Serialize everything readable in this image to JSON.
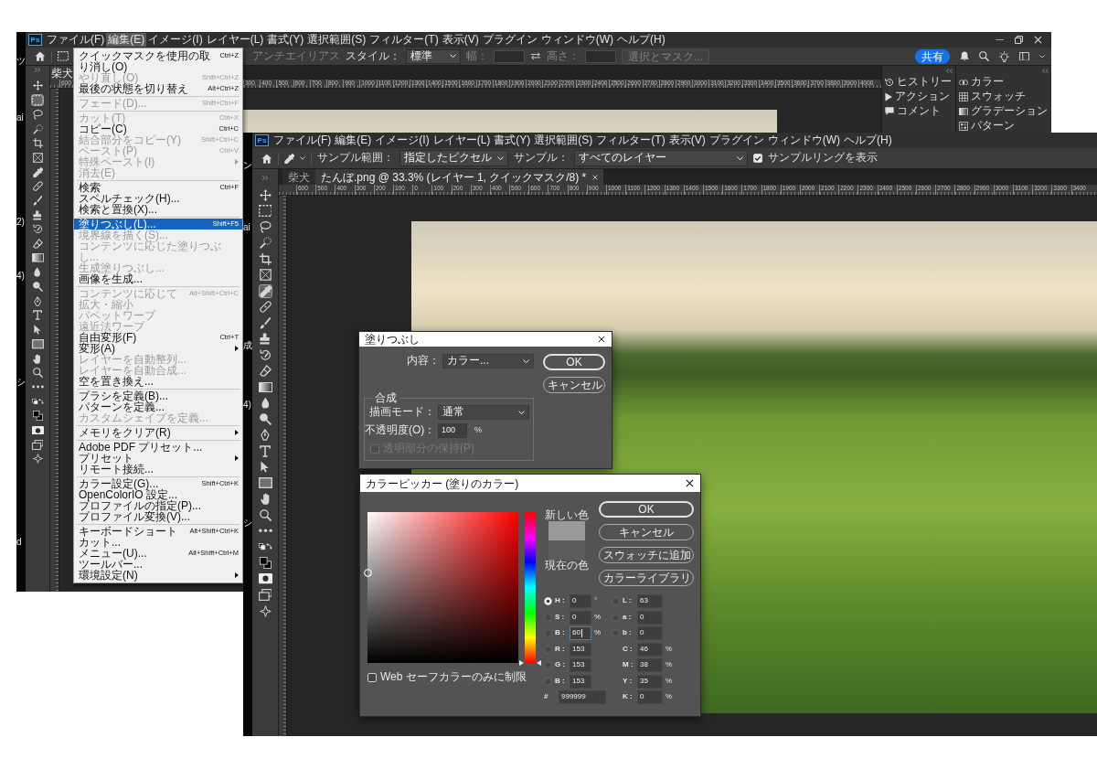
{
  "back_window": {
    "edge_fragments": [
      "ツ",
      "ai",
      "2)",
      "4)",
      "シ",
      "d"
    ],
    "logo": "Ps",
    "menu": [
      {
        "label": "ファイル(F)",
        "selected": false
      },
      {
        "label": "編集(E)",
        "selected": true
      },
      {
        "label": "イメージ(I)",
        "selected": false
      },
      {
        "label": "レイヤー(L)",
        "selected": false
      },
      {
        "label": "書式(Y)",
        "selected": false
      },
      {
        "label": "選択範囲(S)",
        "selected": false
      },
      {
        "label": "フィルター(T)",
        "selected": false
      },
      {
        "label": "表示(V)",
        "selected": false
      },
      {
        "label": "プラグイン",
        "selected": false
      },
      {
        "label": "ウィンドウ(W)",
        "selected": false
      },
      {
        "label": "ヘルプ(H)",
        "selected": false
      }
    ],
    "options_bar": [
      {
        "kind": "label",
        "text": "アンチエイリアス",
        "disabled": true
      },
      {
        "kind": "label",
        "text": "スタイル：",
        "disabled": false
      },
      {
        "kind": "select",
        "value": "標準",
        "disabled": false
      },
      {
        "kind": "label",
        "text": "幅：",
        "disabled": true
      },
      {
        "kind": "input",
        "disabled": true
      },
      {
        "kind": "swap",
        "disabled": false
      },
      {
        "kind": "label",
        "text": "高さ：",
        "disabled": true
      },
      {
        "kind": "input",
        "disabled": true
      },
      {
        "kind": "button",
        "text": "選択とマスク...",
        "disabled": true
      }
    ],
    "share_button": "共有",
    "tools": [
      {
        "kind": "move",
        "selected": false
      },
      {
        "kind": "marquee",
        "selected": true
      },
      {
        "kind": "lasso",
        "selected": false
      },
      {
        "kind": "quickselect",
        "selected": false
      },
      {
        "kind": "crop",
        "selected": false
      },
      {
        "kind": "frame",
        "selected": false
      },
      {
        "kind": "eyedropper",
        "selected": false
      },
      {
        "kind": "heal",
        "selected": false
      },
      {
        "kind": "brush",
        "selected": false
      },
      {
        "kind": "stamp",
        "selected": false
      },
      {
        "kind": "historybrush",
        "selected": false
      },
      {
        "kind": "eraser",
        "selected": false
      },
      {
        "kind": "gradient",
        "selected": false
      },
      {
        "kind": "blur",
        "selected": false
      },
      {
        "kind": "dodge",
        "selected": false
      },
      {
        "kind": "pen",
        "selected": false
      },
      {
        "kind": "type",
        "selected": false
      },
      {
        "kind": "pathselect",
        "selected": false
      },
      {
        "kind": "rectangle",
        "selected": false
      },
      {
        "kind": "hand",
        "selected": false
      },
      {
        "kind": "zoom",
        "selected": false
      },
      {
        "kind": "more",
        "selected": false
      },
      {
        "kind": "swap",
        "selected": false
      },
      {
        "kind": "colors",
        "selected": false
      },
      {
        "kind": "quickmask",
        "selected": false
      },
      {
        "kind": "screenmode",
        "selected": false
      },
      {
        "kind": "sparkle",
        "selected": false
      }
    ],
    "tabs": [
      {
        "label": "柴犬",
        "selected": true,
        "closable": false
      }
    ],
    "ruler_left_labels": [
      "600"
    ],
    "ruler_labels": [
      "300",
      "400",
      "500",
      "600",
      "700",
      "800",
      "900",
      "1000",
      "1100",
      "1200",
      "1300",
      "1400",
      "1500",
      "1600",
      "1700",
      "1800",
      "1900",
      "2000",
      "2100",
      "2200",
      "2300",
      "2400",
      "2500",
      "2600",
      "2700",
      "2800",
      "2900",
      "3000",
      "3100",
      "3200",
      "3300",
      "3400",
      "3500",
      "3600",
      "3700",
      "3800",
      "3900",
      "4000"
    ],
    "dock": [
      [
        {
          "kind": "history",
          "label": "ヒストリー"
        },
        {
          "kind": "actions",
          "label": "アクション"
        },
        {
          "kind": "comments",
          "label": "コメント"
        }
      ],
      [
        {
          "kind": "color",
          "label": "カラー"
        },
        {
          "kind": "swatches",
          "label": "スウォッチ"
        },
        {
          "kind": "gradients",
          "label": "グラデーション"
        },
        {
          "kind": "patterns",
          "label": "パターン"
        }
      ]
    ],
    "edit_menu": {
      "sections": [
        {
          "items": [
            {
              "label": "クイックマスクを使用の取り消し(O)",
              "shortcut": "Ctrl+Z",
              "arrow": false,
              "disabled": false,
              "selected": false
            },
            {
              "label": "やり直し(O)",
              "shortcut": "Shift+Ctrl+Z",
              "arrow": false,
              "disabled": true,
              "selected": false
            },
            {
              "label": "最後の状態を切り替え",
              "shortcut": "Alt+Ctrl+Z",
              "arrow": false,
              "disabled": false,
              "selected": false
            }
          ]
        },
        {
          "items": [
            {
              "label": "フェード(D)...",
              "shortcut": "Shift+Ctrl+F",
              "arrow": false,
              "disabled": true,
              "selected": false
            }
          ]
        },
        {
          "items": [
            {
              "label": "カット(T)",
              "shortcut": "Ctrl+X",
              "arrow": false,
              "disabled": true,
              "selected": false
            },
            {
              "label": "コピー(C)",
              "shortcut": "Ctrl+C",
              "arrow": false,
              "disabled": false,
              "selected": false
            },
            {
              "label": "結合部分をコピー(Y)",
              "shortcut": "Shift+Ctrl+C",
              "arrow": false,
              "disabled": true,
              "selected": false
            },
            {
              "label": "ペースト(P)",
              "shortcut": "Ctrl+V",
              "arrow": false,
              "disabled": true,
              "selected": false
            },
            {
              "label": "特殊ペースト(I)",
              "arrow": true,
              "disabled": true,
              "selected": false
            },
            {
              "label": "消去(E)",
              "arrow": false,
              "disabled": true,
              "selected": false
            }
          ]
        },
        {
          "items": [
            {
              "label": "検索",
              "shortcut": "Ctrl+F",
              "arrow": false,
              "disabled": false,
              "selected": false
            },
            {
              "label": "スペルチェック(H)...",
              "arrow": false,
              "disabled": false,
              "selected": false
            },
            {
              "label": "検索と置換(X)...",
              "arrow": false,
              "disabled": false,
              "selected": false
            }
          ]
        },
        {
          "items": [
            {
              "label": "塗りつぶし(L)...",
              "shortcut": "Shift+F5",
              "arrow": false,
              "disabled": false,
              "selected": true
            },
            {
              "label": "境界線を描く(S)...",
              "arrow": false,
              "disabled": true,
              "selected": false
            },
            {
              "label": "コンテンツに応じた塗りつぶし...",
              "arrow": false,
              "disabled": true,
              "selected": false
            },
            {
              "label": "生成塗りつぶし...",
              "arrow": false,
              "disabled": true,
              "selected": false
            },
            {
              "label": "画像を生成...",
              "arrow": false,
              "disabled": false,
              "selected": false
            }
          ]
        },
        {
          "items": [
            {
              "label": "コンテンツに応じて拡大・縮小",
              "shortcut": "Alt+Shift+Ctrl+C",
              "arrow": false,
              "disabled": true,
              "selected": false
            },
            {
              "label": "パペットワープ",
              "arrow": false,
              "disabled": true,
              "selected": false
            },
            {
              "label": "遠近法ワープ",
              "arrow": false,
              "disabled": true,
              "selected": false
            },
            {
              "label": "自由変形(F)",
              "shortcut": "Ctrl+T",
              "arrow": false,
              "disabled": false,
              "selected": false
            },
            {
              "label": "変形(A)",
              "arrow": true,
              "disabled": false,
              "selected": false
            },
            {
              "label": "レイヤーを自動整列...",
              "arrow": false,
              "disabled": true,
              "selected": false
            },
            {
              "label": "レイヤーを自動合成...",
              "arrow": false,
              "disabled": true,
              "selected": false
            },
            {
              "label": "空を置き換え...",
              "arrow": false,
              "disabled": false,
              "selected": false
            }
          ]
        },
        {
          "items": [
            {
              "label": "ブラシを定義(B)...",
              "arrow": false,
              "disabled": false,
              "selected": false
            },
            {
              "label": "パターンを定義...",
              "arrow": false,
              "disabled": false,
              "selected": false
            },
            {
              "label": "カスタムシェイプを定義...",
              "arrow": false,
              "disabled": true,
              "selected": false
            }
          ]
        },
        {
          "items": [
            {
              "label": "メモリをクリア(R)",
              "arrow": true,
              "disabled": false,
              "selected": false
            }
          ]
        },
        {
          "items": [
            {
              "label": "Adobe PDF プリセット...",
              "arrow": false,
              "disabled": false,
              "selected": false
            },
            {
              "label": "プリセット",
              "arrow": true,
              "disabled": false,
              "selected": false
            },
            {
              "label": "リモート接続...",
              "arrow": false,
              "disabled": false,
              "selected": false
            }
          ]
        },
        {
          "items": [
            {
              "label": "カラー設定(G)...",
              "shortcut": "Shift+Ctrl+K",
              "arrow": false,
              "disabled": false,
              "selected": false
            },
            {
              "label": "OpenColorIO 設定...",
              "arrow": false,
              "disabled": false,
              "selected": false
            },
            {
              "label": "プロファイルの指定(P)...",
              "arrow": false,
              "disabled": false,
              "selected": false
            },
            {
              "label": "プロファイル変換(V)...",
              "arrow": false,
              "disabled": false,
              "selected": false
            }
          ]
        },
        {
          "items": [
            {
              "label": "キーボードショートカット...",
              "shortcut": "Alt+Shift+Ctrl+K",
              "arrow": false,
              "disabled": false,
              "selected": false
            },
            {
              "label": "メニュー(U)...",
              "shortcut": "Alt+Shift+Ctrl+M",
              "arrow": false,
              "disabled": false,
              "selected": false
            },
            {
              "label": "ツールバー...",
              "arrow": false,
              "disabled": false,
              "selected": false
            },
            {
              "label": "環境設定(N)",
              "arrow": true,
              "disabled": false,
              "selected": false
            }
          ]
        }
      ]
    }
  },
  "front_window": {
    "edge_fragments": [
      "ン",
      "ai",
      "成",
      "4)",
      "シ"
    ],
    "logo": "Ps",
    "menu": [
      {
        "label": "ファイル(F)",
        "selected": false
      },
      {
        "label": "編集(E)",
        "selected": false
      },
      {
        "label": "イメージ(I)",
        "selected": false
      },
      {
        "label": "レイヤー(L)",
        "selected": false
      },
      {
        "label": "書式(Y)",
        "selected": false
      },
      {
        "label": "選択範囲(S)",
        "selected": false
      },
      {
        "label": "フィルター(T)",
        "selected": false
      },
      {
        "label": "表示(V)",
        "selected": false
      },
      {
        "label": "プラグイン",
        "selected": false
      },
      {
        "label": "ウィンドウ(W)",
        "selected": false
      },
      {
        "label": "ヘルプ(H)",
        "selected": false
      }
    ],
    "options_bar": [
      {
        "kind": "label",
        "text": "サンプル範囲：",
        "disabled": false
      },
      {
        "kind": "select",
        "value": "指定したピクセル",
        "disabled": false
      },
      {
        "kind": "label",
        "text": "サンプル：",
        "disabled": false
      },
      {
        "kind": "select",
        "value": "すべてのレイヤー",
        "disabled": false
      },
      {
        "kind": "checkbox",
        "text": "サンプルリングを表示",
        "checked": true,
        "disabled": false
      }
    ],
    "tools": [
      {
        "kind": "move",
        "selected": false
      },
      {
        "kind": "marquee",
        "selected": false
      },
      {
        "kind": "lasso",
        "selected": false
      },
      {
        "kind": "quickselect",
        "selected": false
      },
      {
        "kind": "crop",
        "selected": false
      },
      {
        "kind": "frame",
        "selected": false
      },
      {
        "kind": "eyedropper",
        "selected": true
      },
      {
        "kind": "heal",
        "selected": false
      },
      {
        "kind": "brush",
        "selected": false
      },
      {
        "kind": "stamp",
        "selected": false
      },
      {
        "kind": "historybrush",
        "selected": false
      },
      {
        "kind": "eraser",
        "selected": false
      },
      {
        "kind": "gradient",
        "selected": false
      },
      {
        "kind": "blur",
        "selected": false
      },
      {
        "kind": "dodge",
        "selected": false
      },
      {
        "kind": "pen",
        "selected": false
      },
      {
        "kind": "type",
        "selected": false
      },
      {
        "kind": "pathselect",
        "selected": false
      },
      {
        "kind": "rectangle",
        "selected": false
      },
      {
        "kind": "hand",
        "selected": false
      },
      {
        "kind": "zoom",
        "selected": false
      },
      {
        "kind": "more",
        "selected": false
      },
      {
        "kind": "swap",
        "selected": false
      },
      {
        "kind": "colors",
        "selected": false
      },
      {
        "kind": "quickmask",
        "selected": false
      },
      {
        "kind": "screenmode",
        "selected": false
      },
      {
        "kind": "sparkle",
        "selected": false
      }
    ],
    "tabs": [
      {
        "label": "柴犬",
        "selected": false,
        "closable": false
      },
      {
        "label": "たんぼ.png @ 33.3% (レイヤー 1, クイックマスク/8) *",
        "selected": true,
        "closable": true
      }
    ],
    "ruler_labels": [
      "600",
      "500",
      "400",
      "300",
      "200",
      "100",
      "0",
      "100",
      "200",
      "300",
      "400",
      "500",
      "600",
      "700",
      "800",
      "900",
      "1000",
      "1100",
      "1200",
      "1300",
      "1400",
      "1500",
      "1600",
      "1700",
      "1800",
      "1900",
      "2000",
      "2100",
      "2200",
      "2300",
      "2400",
      "2500",
      "2600",
      "2700",
      "2800",
      "2900",
      "3000",
      "3100",
      "3200",
      "3300",
      "3400"
    ]
  },
  "fill_dialog": {
    "title": "塗りつぶし",
    "contents": {
      "label": "内容：",
      "value": "カラー..."
    },
    "buttons": [
      {
        "label": "OK",
        "default": true
      },
      {
        "label": "キャンセル",
        "default": false
      }
    ],
    "blending": {
      "title": "合成",
      "mode": {
        "label": "描画モード：",
        "value": "通常"
      },
      "opacity": {
        "label": "不透明度(O)：",
        "value": "100",
        "unit": "%"
      },
      "preserve_transparency": {
        "label": "透明部分の保持(P)",
        "checked": false,
        "disabled": true
      }
    }
  },
  "color_picker": {
    "title": "カラーピッカー (塗りのカラー)",
    "buttons": [
      {
        "label": "OK",
        "default": true
      },
      {
        "label": "キャンセル",
        "default": false
      },
      {
        "label": "スウォッチに追加",
        "default": false
      },
      {
        "label": "カラーライブラリ",
        "default": false
      }
    ],
    "swatches": [
      {
        "label": "新しい色",
        "color": "#999999"
      },
      {
        "label": "現在の色",
        "color": "#5c5c5c"
      }
    ],
    "hue_slider": {
      "level": 0
    },
    "hsb_rgb": [
      {
        "label": "H :",
        "value": "0",
        "unit": "°",
        "selected": true,
        "focused": false
      },
      {
        "label": "S :",
        "value": "0",
        "unit": "%",
        "selected": false,
        "focused": false
      },
      {
        "label": "B :",
        "value": "60",
        "unit": "%",
        "selected": false,
        "focused": true
      },
      {
        "label": "R :",
        "value": "153",
        "selected": false,
        "focused": false
      },
      {
        "label": "G :",
        "value": "153",
        "selected": false,
        "focused": false
      },
      {
        "label": "B :",
        "value": "153",
        "selected": false,
        "focused": false
      }
    ],
    "lab": [
      {
        "label": "L :",
        "value": "63",
        "selected": false
      },
      {
        "label": "a :",
        "value": "0",
        "selected": false
      },
      {
        "label": "b :",
        "value": "0",
        "selected": false
      }
    ],
    "cmyk": [
      {
        "label": "C :",
        "value": "46",
        "unit": "%"
      },
      {
        "label": "M :",
        "value": "38",
        "unit": "%"
      },
      {
        "label": "Y :",
        "value": "35",
        "unit": "%"
      },
      {
        "label": "K :",
        "value": "0",
        "unit": "%"
      }
    ],
    "hex": {
      "label": "#",
      "value": "999999"
    },
    "web_safe_only": {
      "label": "Web セーフカラーのみに制限",
      "checked": false
    }
  }
}
